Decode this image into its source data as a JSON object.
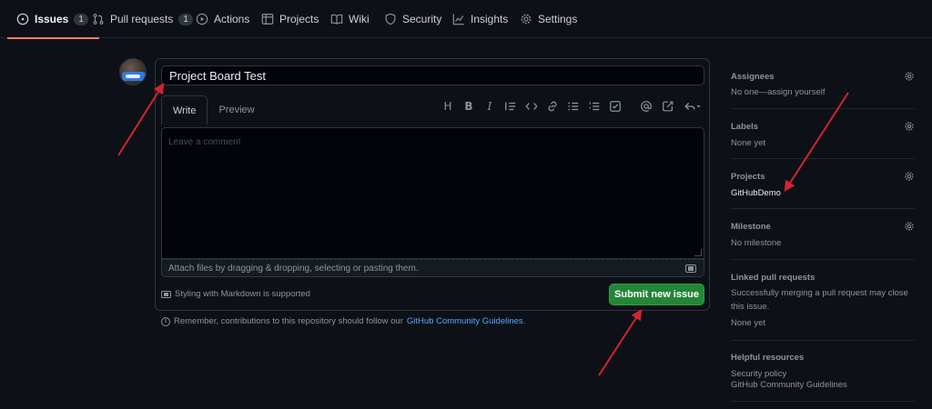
{
  "nav": {
    "tabs": [
      {
        "label": "Issues",
        "count": "1",
        "icon": "issue-opened-icon"
      },
      {
        "label": "Pull requests",
        "count": "1",
        "icon": "git-pull-request-icon"
      },
      {
        "label": "Actions",
        "icon": "play-icon"
      },
      {
        "label": "Projects",
        "icon": "table-icon"
      },
      {
        "label": "Wiki",
        "icon": "book-icon"
      },
      {
        "label": "Security",
        "icon": "shield-icon"
      },
      {
        "label": "Insights",
        "icon": "graph-icon"
      },
      {
        "label": "Settings",
        "icon": "gear-icon"
      }
    ],
    "active_tab": "Issues"
  },
  "issue": {
    "title_value": "Project Board Test",
    "tabs": {
      "write": "Write",
      "preview": "Preview"
    },
    "toolbar": [
      "H",
      "B",
      "I"
    ],
    "comment_placeholder": "Leave a comment",
    "attach_text": "Attach files by dragging & dropping, selecting or pasting them.",
    "styling_text": "Styling with Markdown is supported",
    "submit_label": "Submit new issue",
    "remember_text": "Remember, contributions to this repository should follow our",
    "remember_link": "GitHub Community Guidelines",
    "remember_end": "."
  },
  "sidebar": {
    "assignees": {
      "title": "Assignees",
      "value": "No one—assign yourself"
    },
    "labels": {
      "title": "Labels",
      "value": "None yet"
    },
    "projects": {
      "title": "Projects",
      "value": "GitHubDemo"
    },
    "milestone": {
      "title": "Milestone",
      "value": "No milestone"
    },
    "linked": {
      "title": "Linked pull requests",
      "desc": "Successfully merging a pull request may close this issue.",
      "value": "None yet"
    },
    "helpful": {
      "title": "Helpful resources",
      "links": [
        "Security policy",
        "GitHub Community Guidelines"
      ]
    }
  },
  "colors": {
    "background": "#0d1117",
    "accent_tab": "#f78166",
    "submit": "#238636",
    "link": "#58a6ff",
    "annotation_arrow": "#d1242f"
  }
}
